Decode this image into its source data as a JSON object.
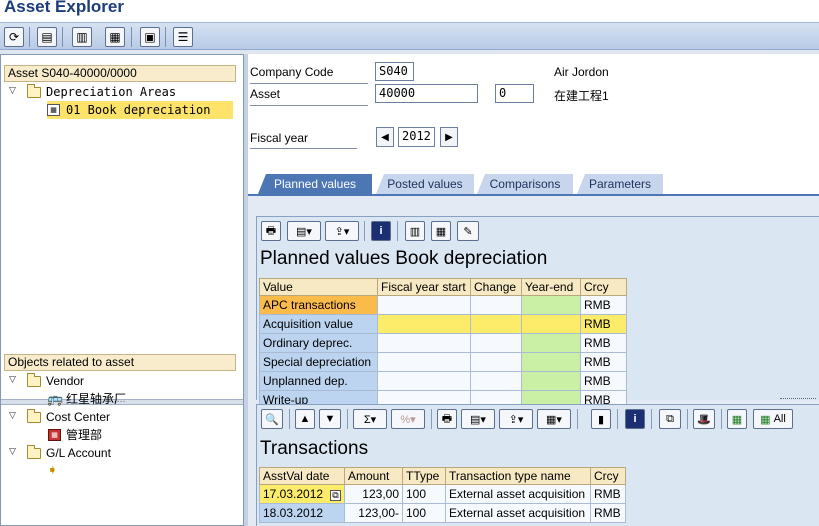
{
  "app": {
    "title": "Asset Explorer"
  },
  "toolbar": {
    "icons": [
      "refresh-icon",
      "save-layout-icon",
      "barcode-icon",
      "overview-icon",
      "display-icon",
      "list-icon"
    ]
  },
  "left": {
    "asset_header": "Asset S040-40000/0000",
    "depr_areas_label": "Depreciation Areas",
    "book_depr_label": "01 Book depreciation",
    "objects_header": "Objects related to asset",
    "vendor_label": "Vendor",
    "vendor_item": "红星轴承厂",
    "cost_center_label": "Cost Center",
    "cost_center_item": "管理部",
    "gl_account_label": "G/L Account"
  },
  "form": {
    "company_code_label": "Company Code",
    "company_code_value": "S040",
    "company_name": "Air Jordon",
    "asset_label": "Asset",
    "asset_value": "40000",
    "subnumber_value": "0",
    "asset_description": "在建工程1",
    "fiscal_year_label": "Fiscal year",
    "fiscal_year_value": "2012"
  },
  "tabs": [
    {
      "label": "Planned values",
      "active": true
    },
    {
      "label": "Posted values"
    },
    {
      "label": "Comparisons"
    },
    {
      "label": "Parameters"
    }
  ],
  "planned": {
    "title": "Planned values Book depreciation",
    "columns": [
      "Value",
      "Fiscal year start",
      "Change",
      "Year-end",
      "Crcy"
    ],
    "rows": [
      {
        "value": "APC transactions",
        "crcy": "RMB"
      },
      {
        "value": "Acquisition value",
        "crcy": "RMB"
      },
      {
        "value": "Ordinary deprec.",
        "crcy": "RMB"
      },
      {
        "value": "Special depreciation",
        "crcy": "RMB"
      },
      {
        "value": "Unplanned dep.",
        "crcy": "RMB"
      },
      {
        "value": "Write-up",
        "crcy": "RMB"
      }
    ]
  },
  "transactions": {
    "title": "Transactions",
    "all_button": "All",
    "columns": [
      "AsstVal date",
      "Amount",
      "TType",
      "Transaction type name",
      "Crcy"
    ],
    "rows": [
      {
        "date": "17.03.2012",
        "amount": "123,00",
        "ttype": "100",
        "name": "External asset acquisition",
        "crcy": "RMB"
      },
      {
        "date": "18.03.2012",
        "amount": "123,00-",
        "ttype": "100",
        "name": "External asset acquisition",
        "crcy": "RMB"
      }
    ]
  }
}
